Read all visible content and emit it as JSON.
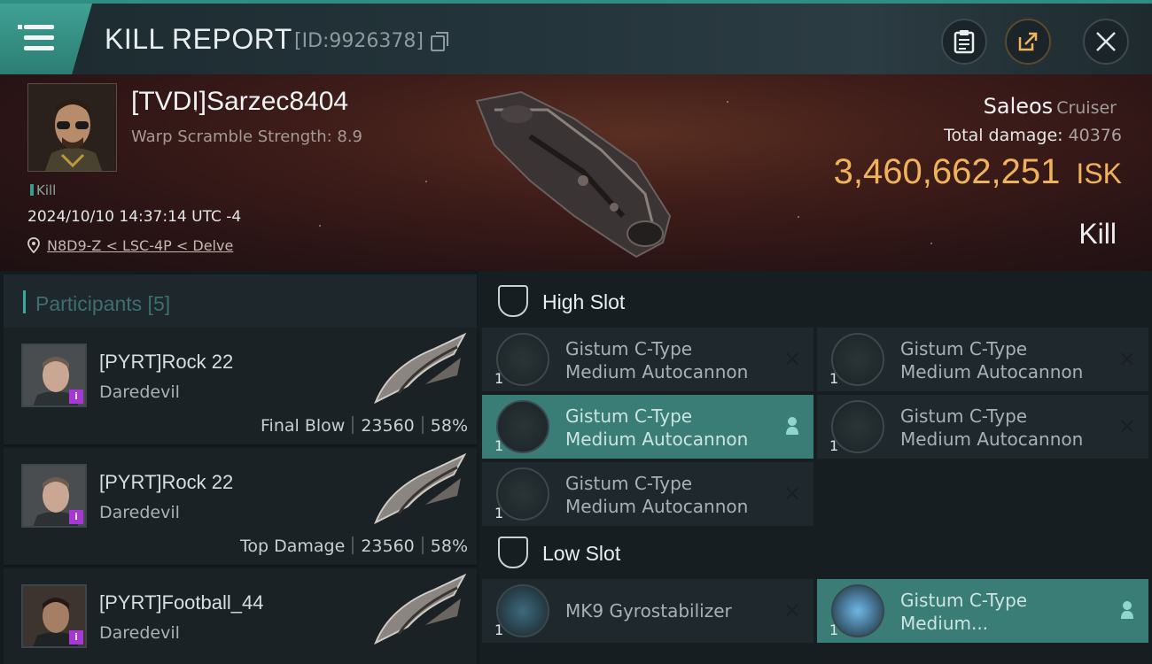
{
  "header": {
    "title": "KILL REPORT",
    "id_text": "[ID:9926378]"
  },
  "victim": {
    "name": "[TVDI]Sarzec8404",
    "subtitle": "Warp Scramble Strength: 8.9",
    "tag": "Kill",
    "datetime": "2024/10/10 14:37:14 UTC -4",
    "location": "N8D9-Z < LSC-4P < Delve",
    "ship": "Saleos",
    "ship_class": "Cruiser",
    "total_damage_label": "Total damage:",
    "total_damage": "40376",
    "isk_value": "3,460,662,251",
    "isk_unit": "ISK",
    "result": "Kill"
  },
  "participants": {
    "label": "Participants [5]",
    "rows": [
      {
        "name": "[PYRT]Rock 22",
        "ship": "Daredevil",
        "role": "Final Blow",
        "damage": "23560",
        "percent": "58%"
      },
      {
        "name": "[PYRT]Rock 22",
        "ship": "Daredevil",
        "role": "Top Damage",
        "damage": "23560",
        "percent": "58%"
      },
      {
        "name": "[PYRT]Football_44",
        "ship": "Daredevil",
        "role": "",
        "damage": "",
        "percent": ""
      }
    ]
  },
  "slots": {
    "high": {
      "label": "High Slot",
      "modules": [
        {
          "line1": "Gistum C-Type",
          "line2": "Medium Autocannon",
          "qty": "1",
          "active": false
        },
        {
          "line1": "Gistum C-Type",
          "line2": "Medium Autocannon",
          "qty": "1",
          "active": false
        },
        {
          "line1": "Gistum C-Type",
          "line2": "Medium Autocannon",
          "qty": "1",
          "active": true
        },
        {
          "line1": "Gistum C-Type",
          "line2": "Medium Autocannon",
          "qty": "1",
          "active": false
        },
        {
          "line1": "Gistum C-Type",
          "line2": "Medium Autocannon",
          "qty": "1",
          "active": false
        }
      ]
    },
    "low": {
      "label": "Low Slot",
      "modules": [
        {
          "line1": "MK9 Gyrostabilizer",
          "qty": "1",
          "active": false
        },
        {
          "line1": "Gistum C-Type",
          "line2": "Medium...",
          "qty": "1",
          "active": true
        }
      ]
    }
  },
  "icons": {
    "menu": "hamburger-menu-icon",
    "copy": "copy-icon",
    "clipboard": "clipboard-icon",
    "share": "share-icon",
    "close": "close-icon",
    "pin": "location-pin-icon",
    "slot": "slot-shield-icon",
    "remove": "x-icon",
    "person": "person-icon"
  },
  "colors": {
    "accent_teal": "#3aa89a",
    "isk_gold": "#f0b25a",
    "banner_red": "#3f1d19",
    "badge_purple": "#a838d6"
  }
}
